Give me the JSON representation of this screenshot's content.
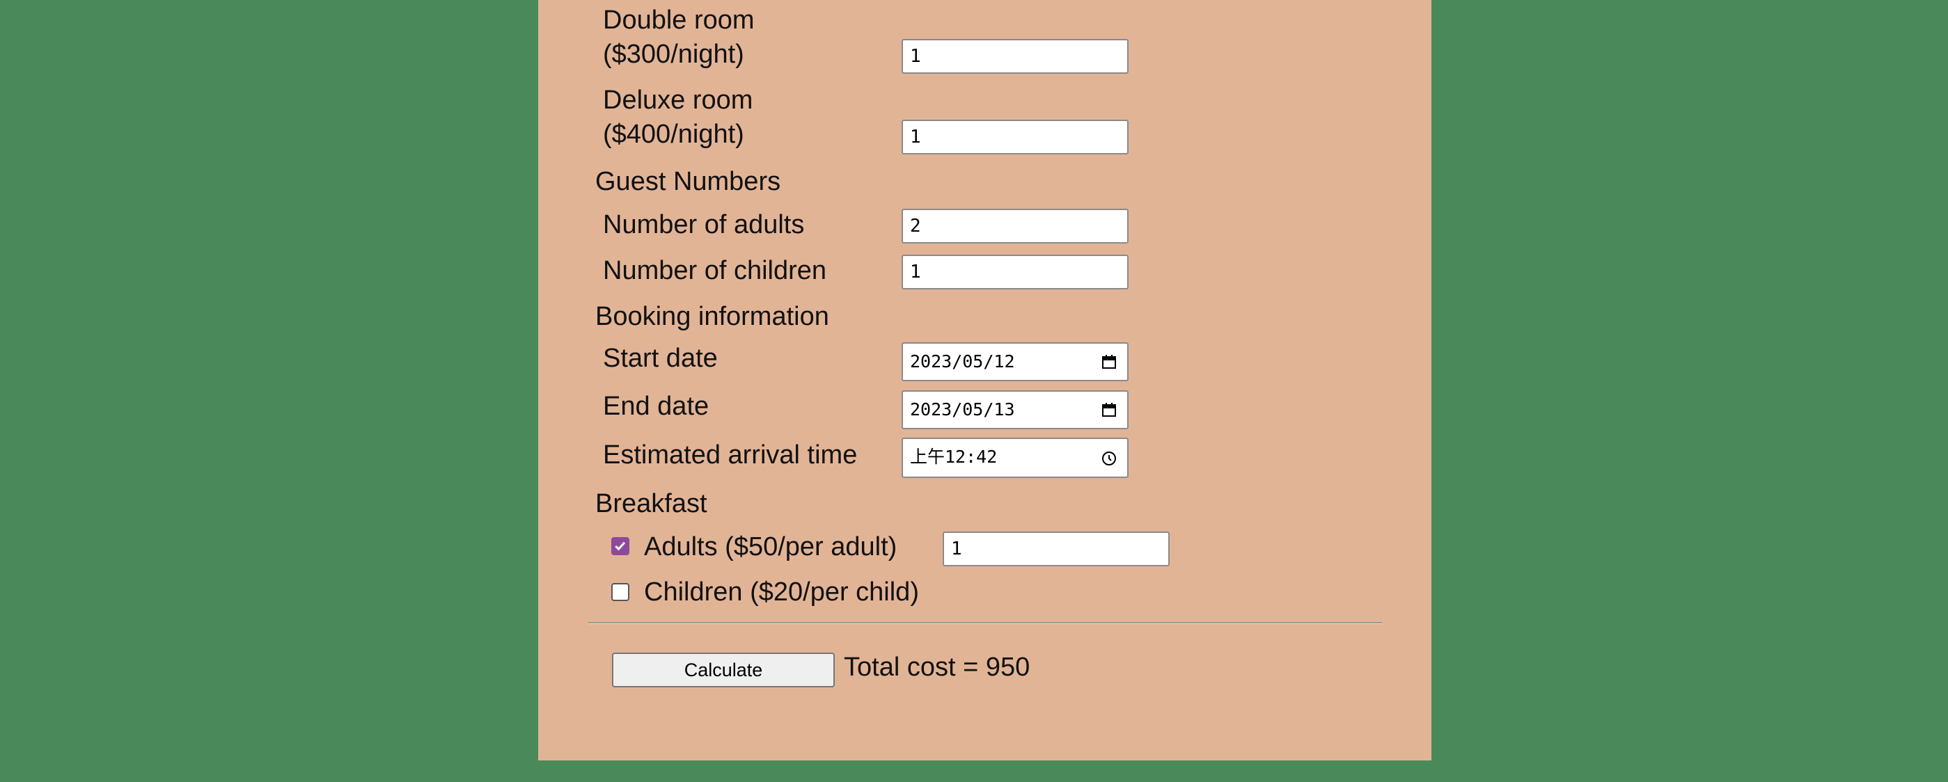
{
  "rooms": {
    "double": {
      "label_line1": "Double room",
      "label_line2": "($300/night)",
      "value": "1"
    },
    "deluxe": {
      "label_line1": "Deluxe room",
      "label_line2": "($400/night)",
      "value": "1"
    }
  },
  "guests": {
    "heading": "Guest Numbers",
    "adults_label": "Number of adults",
    "adults_value": "2",
    "children_label": "Number of children",
    "children_value": "1"
  },
  "booking": {
    "heading": "Booking information",
    "start_label": "Start date",
    "start_value": "2023/05/12",
    "end_label": "End date",
    "end_value": "2023/05/13",
    "arrival_label": "Estimated arrival time",
    "arrival_value": "上午12:42"
  },
  "breakfast": {
    "heading": "Breakfast",
    "adults_label": "Adults ($50/per adult)",
    "adults_checked": true,
    "adults_count": "1",
    "children_label": "Children ($20/per child)",
    "children_checked": false
  },
  "footer": {
    "calculate_label": "Calculate",
    "total_text": "Total cost = 950"
  },
  "icons": {
    "date": "calendar-icon",
    "time": "clock-icon"
  },
  "colors": {
    "page_background": "#4a8a5a",
    "panel_background": "#e2b496",
    "checkbox_accent": "#8d4a9b"
  }
}
